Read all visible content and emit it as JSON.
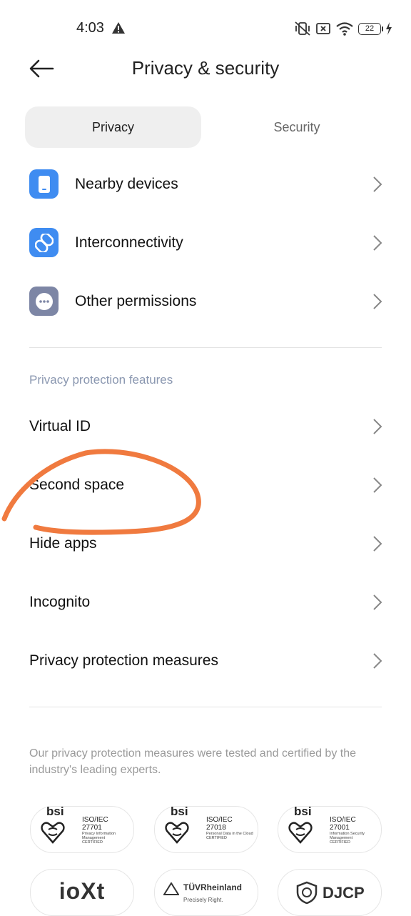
{
  "status_bar": {
    "time": "4:03",
    "battery": "22"
  },
  "header": {
    "title": "Privacy & security"
  },
  "tabs": [
    {
      "label": "Privacy"
    },
    {
      "label": "Security"
    }
  ],
  "top_items": [
    {
      "label": "Nearby devices",
      "icon": "phone-icon",
      "color": "#3f8cf1"
    },
    {
      "label": "Interconnectivity",
      "icon": "link-icon",
      "color": "#3f8cf1"
    },
    {
      "label": "Other permissions",
      "icon": "more-dots-icon",
      "color": "#7d86a5"
    }
  ],
  "section": {
    "title": "Privacy protection features",
    "items": [
      {
        "label": "Virtual ID"
      },
      {
        "label": "Second space"
      },
      {
        "label": "Hide apps"
      },
      {
        "label": "Incognito"
      },
      {
        "label": "Privacy protection measures"
      }
    ]
  },
  "footer": {
    "text": "Our privacy protection measures were tested and certified by the industry's leading experts.",
    "certs": [
      {
        "brand": "bsi",
        "standard": "ISO/IEC",
        "number": "27701",
        "desc": "Privacy Information Management",
        "status": "CERTIFIED"
      },
      {
        "brand": "bsi",
        "standard": "ISO/IEC",
        "number": "27018",
        "desc": "Personal Data in the Cloud",
        "status": "CERTIFIED"
      },
      {
        "brand": "bsi",
        "standard": "ISO/IEC",
        "number": "27001",
        "desc": "Information Security Management",
        "status": "CERTIFIED"
      }
    ],
    "logos": [
      {
        "name": "ioXt"
      },
      {
        "name": "TÜVRheinland",
        "tagline": "Precisely Right."
      },
      {
        "name": "DJCP"
      }
    ]
  },
  "colors": {
    "accent": "#3f8cf1",
    "annotation": "#f07a3f",
    "section_header": "#8a97b0"
  }
}
